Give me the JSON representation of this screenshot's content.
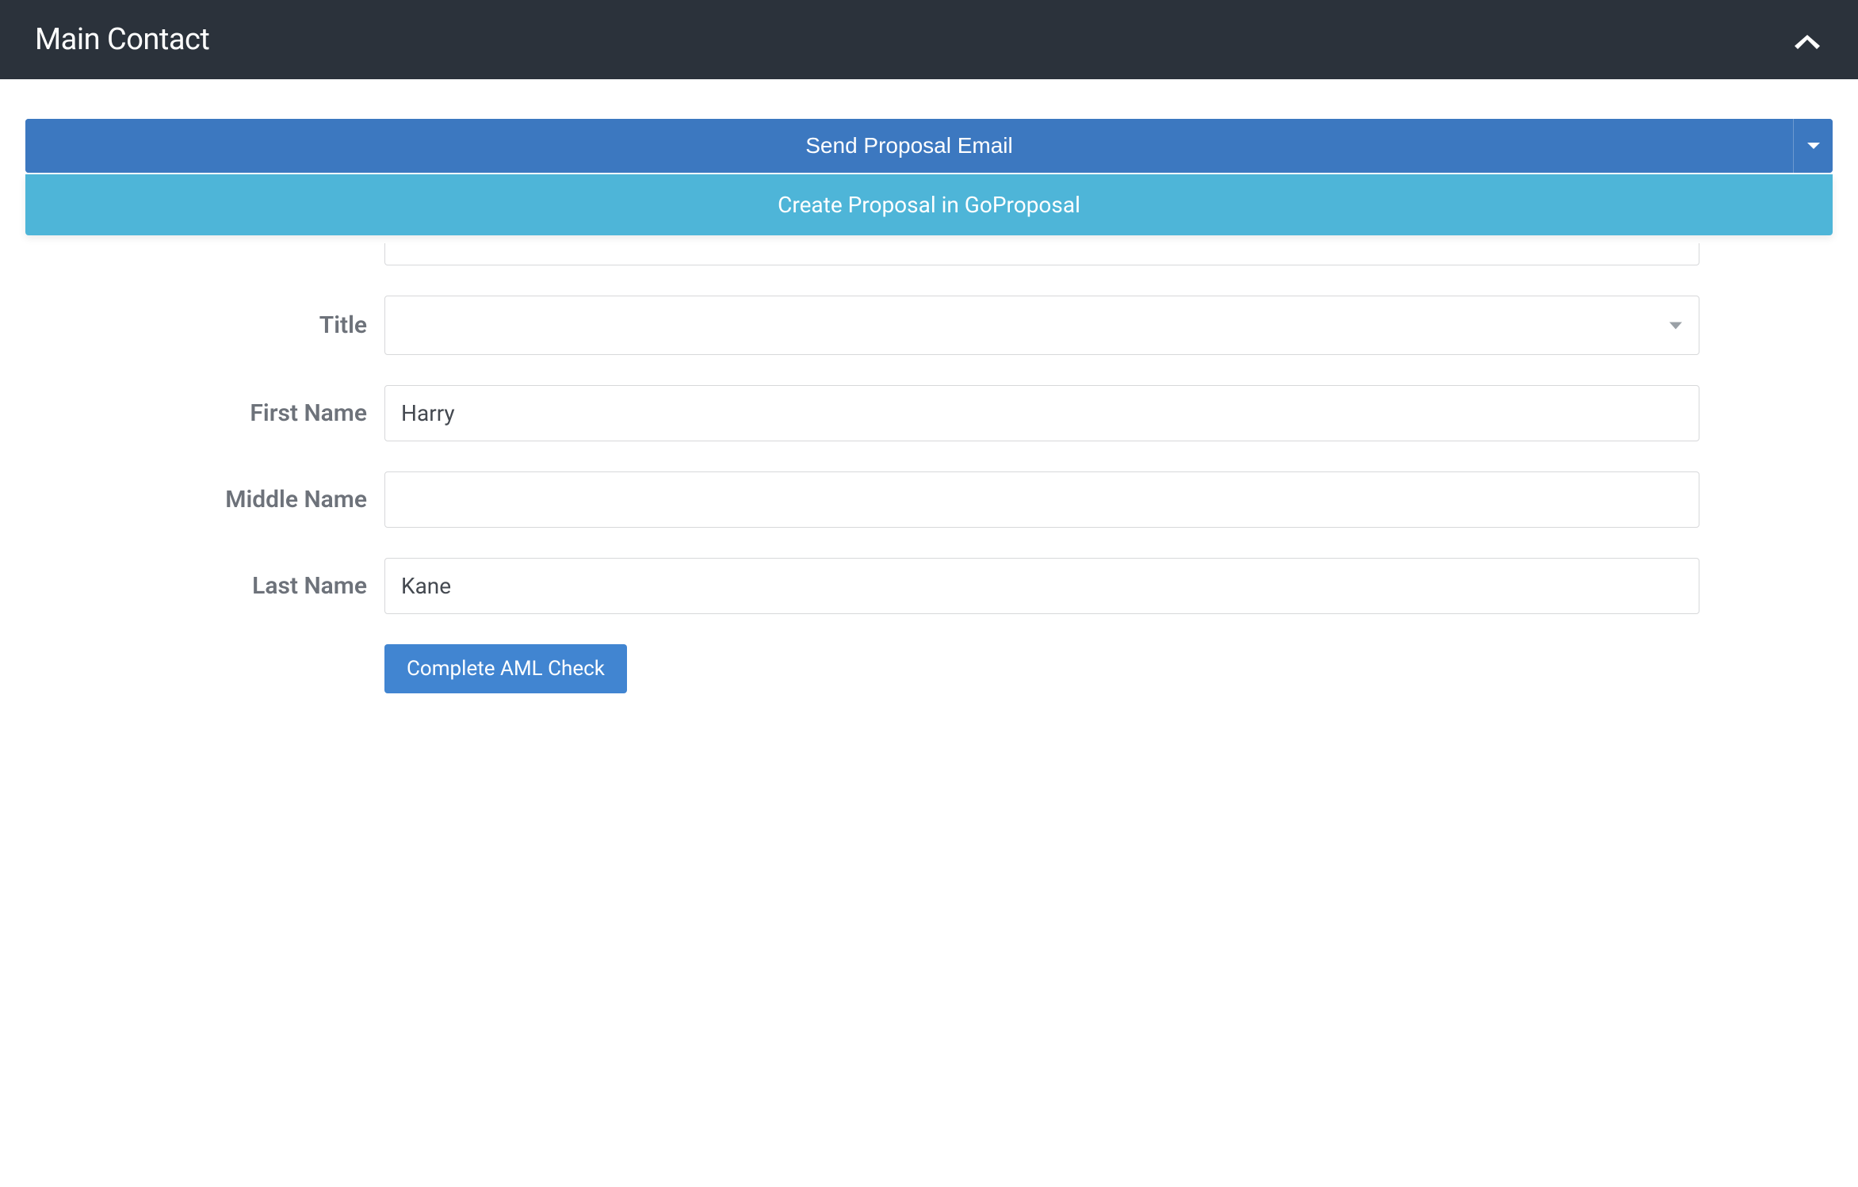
{
  "panel": {
    "title": "Main Contact"
  },
  "actions": {
    "primary_label": "Send Proposal Email",
    "dropdown": {
      "item_label": "Create Proposal in GoProposal"
    }
  },
  "form": {
    "title": {
      "label": "Title",
      "value": ""
    },
    "first_name": {
      "label": "First Name",
      "value": "Harry"
    },
    "middle_name": {
      "label": "Middle Name",
      "value": ""
    },
    "last_name": {
      "label": "Last Name",
      "value": "Kane"
    },
    "aml_button_label": "Complete AML Check"
  }
}
